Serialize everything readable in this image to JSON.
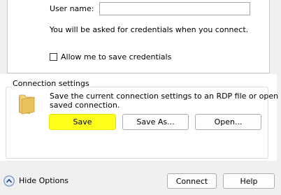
{
  "credentials": {
    "username_label": "User name:",
    "username_value": "",
    "info_text": "You will be asked for credentials when you connect.",
    "save_checkbox_label": "Allow me to save credentials",
    "save_checkbox_checked": false
  },
  "connection_settings": {
    "title": "Connection settings",
    "description_line1": "Save the current connection settings to an RDP file or open a",
    "description_line2": "saved connection.",
    "save_button": "Save",
    "save_as_button": "Save As...",
    "open_button": "Open..."
  },
  "footer": {
    "hide_options": "Hide Options",
    "connect_button": "Connect",
    "help_button": "Help"
  },
  "colors": {
    "highlight": "#ffff1a",
    "folder": "#e8c25a"
  }
}
